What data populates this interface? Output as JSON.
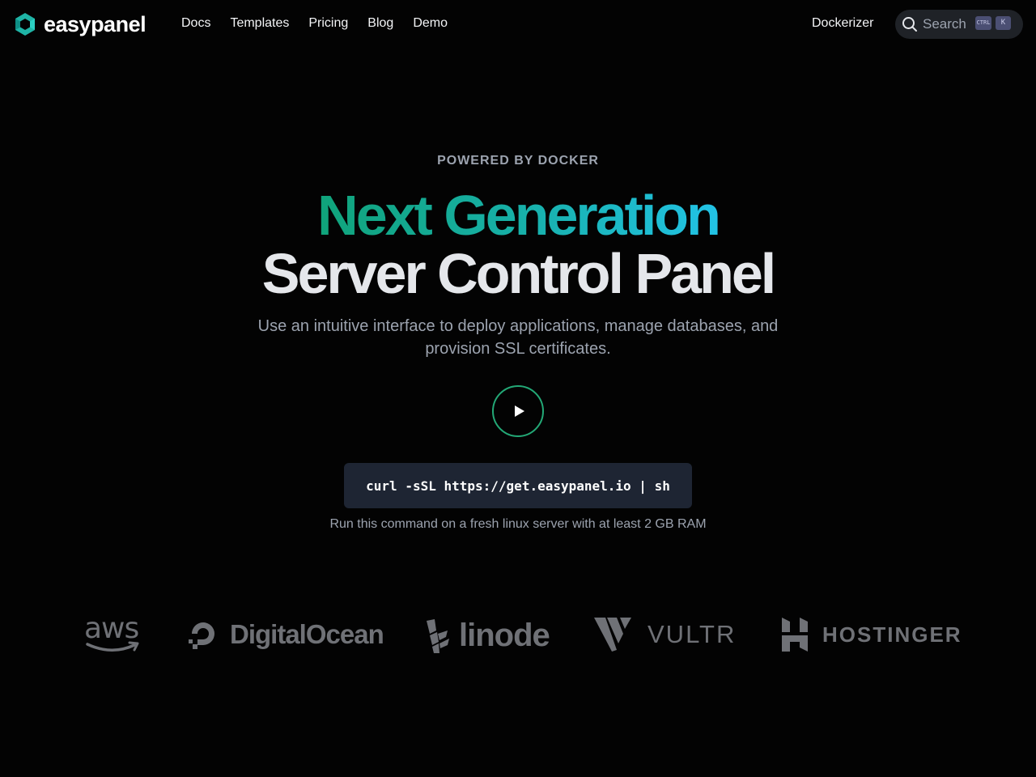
{
  "brand": {
    "name": "easypanel"
  },
  "nav": {
    "links": [
      "Docs",
      "Templates",
      "Pricing",
      "Blog",
      "Demo"
    ],
    "right_link": "Dockerizer",
    "search": {
      "placeholder": "Search",
      "shortcut_ctrl": "CTRL",
      "shortcut_key": "K"
    }
  },
  "hero": {
    "eyebrow": "POWERED BY DOCKER",
    "headline_line1": "Next Generation",
    "headline_line2": "Server Control Panel",
    "subtitle": "Use an intuitive interface to deploy applications, manage databases, and provision SSL certificates.",
    "command": "curl -sSL https://get.easypanel.io | sh",
    "command_note": "Run this command on a fresh linux server with at least 2 GB RAM"
  },
  "providers": {
    "aws": "aws",
    "digitalocean": "DigitalOcean",
    "linode": "linode",
    "vultr": "VULTR",
    "hostinger": "HOSTINGER"
  },
  "colors": {
    "background": "#030303",
    "accent_green": "#10a37a",
    "accent_cyan": "#22c3e6",
    "command_bg": "#1e2533",
    "logo_gray": "#6f7176"
  }
}
